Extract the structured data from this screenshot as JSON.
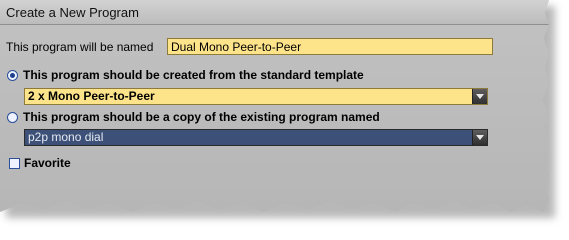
{
  "dialog": {
    "title": "Create a New Program",
    "name_label": "This program will be named",
    "name_value": "Dual Mono Peer-to-Peer",
    "option_template_label": "This program should be created from the standard template",
    "option_template_selected": true,
    "template_select_value": "2 x Mono Peer-to-Peer",
    "option_copy_label": "This program should be a copy of the existing program named",
    "option_copy_selected": false,
    "copy_select_value": "p2p mono dial",
    "favorite_label": "Favorite",
    "favorite_checked": false
  },
  "colors": {
    "input_highlight": "#fde48a",
    "copy_select_bg": "#3d5178",
    "panel_bg": "#bdbdbd"
  }
}
